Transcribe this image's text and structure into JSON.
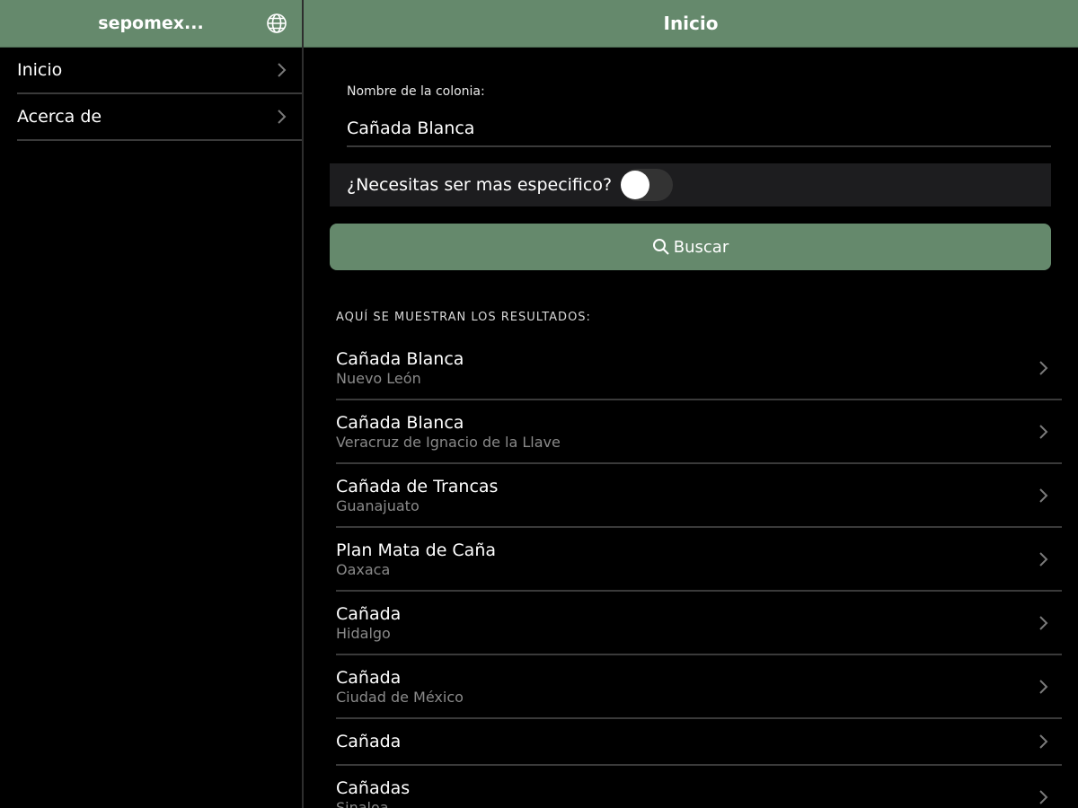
{
  "sidebar": {
    "title": "sepomex...",
    "items": [
      {
        "label": "Inicio"
      },
      {
        "label": "Acerca de"
      }
    ]
  },
  "main": {
    "title": "Inicio",
    "field_label": "Nombre de la colonia:",
    "field_value": "Cañada Blanca",
    "toggle_label": "¿Necesitas ser mas especifico?",
    "toggle_on": false,
    "search_label": "Buscar",
    "results_heading": "AQUÍ SE MUESTRAN LOS RESULTADOS:",
    "results": [
      {
        "name": "Cañada Blanca",
        "state": "Nuevo León"
      },
      {
        "name": "Cañada Blanca",
        "state": "Veracruz de Ignacio de la Llave"
      },
      {
        "name": "Cañada de Trancas",
        "state": "Guanajuato"
      },
      {
        "name": "Plan Mata de Caña",
        "state": "Oaxaca"
      },
      {
        "name": "Cañada",
        "state": "Hidalgo"
      },
      {
        "name": "Cañada",
        "state": "Ciudad de México"
      },
      {
        "name": "Cañada",
        "state": ""
      },
      {
        "name": "Cañadas",
        "state": "Sinaloa"
      }
    ]
  },
  "colors": {
    "accent": "#65896c",
    "background": "#000000",
    "divider": "#3a3a3a",
    "secondary_text": "#8a8a8a"
  }
}
